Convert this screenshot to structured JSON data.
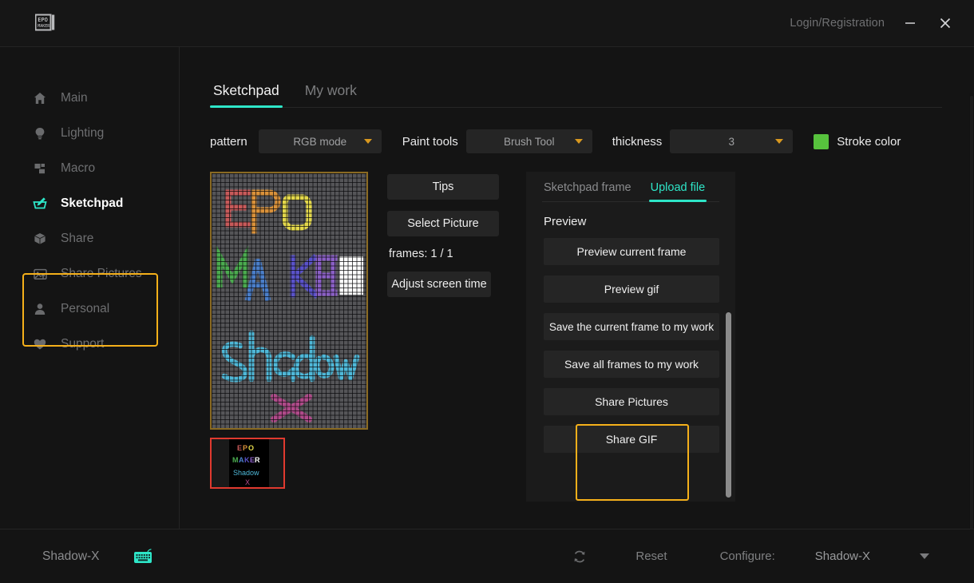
{
  "window": {
    "logo_icon": "epomaker-logo-icon",
    "login_label": "Login/Registration",
    "minimize_icon": "minimize-icon",
    "close_icon": "close-icon"
  },
  "sidebar": {
    "items": [
      {
        "label": "Main",
        "icon": "home-icon",
        "active": false
      },
      {
        "label": "Lighting",
        "icon": "bulb-icon",
        "active": false
      },
      {
        "label": "Macro",
        "icon": "macro-squares-icon",
        "active": false
      },
      {
        "label": "Sketchpad",
        "icon": "sketchpad-icon",
        "active": true
      },
      {
        "label": "Share",
        "icon": "box-icon",
        "active": false
      },
      {
        "label": "Share Pictures",
        "icon": "image-upload-icon",
        "active": false
      },
      {
        "label": "Personal",
        "icon": "person-icon",
        "active": false
      },
      {
        "label": "Support",
        "icon": "heart-icon",
        "active": false
      }
    ],
    "highlight_color": "#f5b01a"
  },
  "main": {
    "tabs": [
      {
        "label": "Sketchpad",
        "active": true
      },
      {
        "label": "My work",
        "active": false
      }
    ],
    "toolbar": {
      "pattern_label": "pattern",
      "pattern_value": "RGB mode",
      "paint_tools_label": "Paint tools",
      "paint_tools_value": "Brush Tool",
      "thickness_label": "thickness",
      "thickness_value": "3",
      "stroke_color_label": "Stroke color",
      "stroke_color_hex": "#57c23d"
    },
    "canvas": {
      "name": "sketchpad-canvas",
      "border_hex": "#8a6a22",
      "background_hex": "#555558"
    },
    "thumbnail": {
      "name": "frame-thumbnail",
      "selected_border_hex": "#e03a2f"
    },
    "middle_controls": {
      "tips_label": "Tips",
      "select_picture_label": "Select Picture",
      "frames_label": "frames: 1 / 1",
      "adjust_screen_time_label": "Adjust screen time"
    },
    "right_panel": {
      "tabs": [
        {
          "label": "Sketchpad frame",
          "active": false
        },
        {
          "label": "Upload file",
          "active": true
        }
      ],
      "section_title": "Preview",
      "buttons": [
        "Preview current frame",
        "Preview gif",
        "Save the current frame to my work",
        "Save all frames to my work",
        "Share Pictures",
        "Share GIF"
      ],
      "highlight_color": "#f5b01a",
      "accent_hex": "#2ee6c8"
    }
  },
  "footer": {
    "device_name": "Shadow-X",
    "keyboard_icon": "keyboard-icon",
    "refresh_icon": "refresh-icon",
    "reset_label": "Reset",
    "configure_label": "Configure:",
    "configure_value": "Shadow-X",
    "configure_caret_icon": "chevron-down-icon"
  },
  "drawing": {
    "description": "EPO MAKER Shadow X pixel art on LED matrix",
    "strokes": [
      {
        "text": "E",
        "color": "#c85a5a"
      },
      {
        "text": "P",
        "color": "#d9913a"
      },
      {
        "text": "O",
        "color": "#e3d84b"
      },
      {
        "text": "M",
        "color": "#4bab4f"
      },
      {
        "text": "A",
        "color": "#4a7ec9"
      },
      {
        "text": "K",
        "color": "#5a52c9"
      },
      {
        "text": "E",
        "color": "#8a5fc4"
      },
      {
        "text": "R",
        "color": "#ffffff"
      },
      {
        "text": "Shadow",
        "color": "#4fb8d8"
      },
      {
        "text": "X",
        "color": "#b04a8a"
      }
    ]
  }
}
